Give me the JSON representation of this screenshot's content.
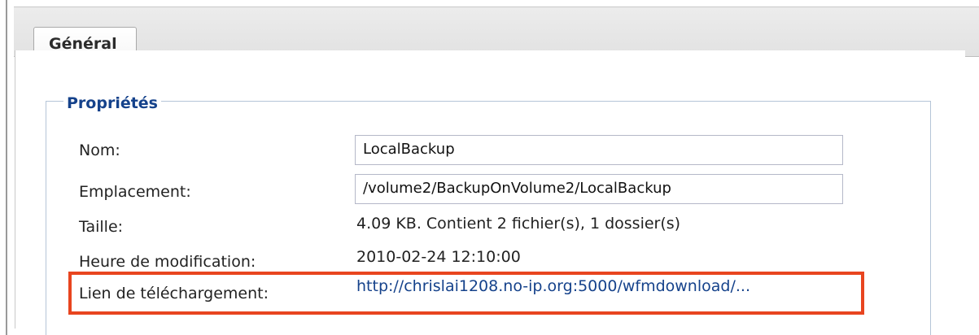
{
  "tabs": [
    {
      "label": "Général"
    }
  ],
  "properties": {
    "legend": "Propriétés",
    "name": {
      "label": "Nom:",
      "value": "LocalBackup"
    },
    "location": {
      "label": "Emplacement:",
      "value": "/volume2/BackupOnVolume2/LocalBackup"
    },
    "size": {
      "label": "Taille:",
      "value": "4.09 KB. Contient 2 fichier(s), 1 dossier(s)"
    },
    "modified": {
      "label": "Heure de modification:",
      "value": "2010-02-24 12:10:00"
    },
    "download_link": {
      "label": "Lien de téléchargement:",
      "value": "http://chrislai1208.no-ip.org:5000/wfmdownload/..."
    }
  },
  "colors": {
    "legend": "#15428b",
    "link": "#15428b",
    "highlight": "#e8451f"
  }
}
